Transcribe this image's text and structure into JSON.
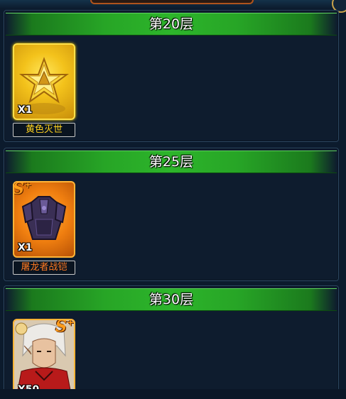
{
  "floors": [
    {
      "title": "第20层",
      "reward": {
        "name": "黄色灭世",
        "count": "X1",
        "icon": "gold-star-emblem-icon",
        "rarity_color": "#ffd21e"
      }
    },
    {
      "title": "第25层",
      "reward": {
        "name": "屠龙者战铠",
        "count": "X1",
        "icon": "dark-armor-icon",
        "badge": "S",
        "badge_sup": "+",
        "rarity_color": "#ff7a22"
      }
    },
    {
      "title": "第30层",
      "reward": {
        "count": "X50",
        "icon": "white-haired-hero-portrait-icon",
        "badge": "S",
        "badge_sup": "+",
        "rarity_color": "#ff7a22"
      }
    }
  ],
  "colors": {
    "header_green": "#27a526",
    "panel_bg": "#0e1c2e",
    "frame_gold": "#ffe14a",
    "frame_orange": "#ffb437"
  }
}
